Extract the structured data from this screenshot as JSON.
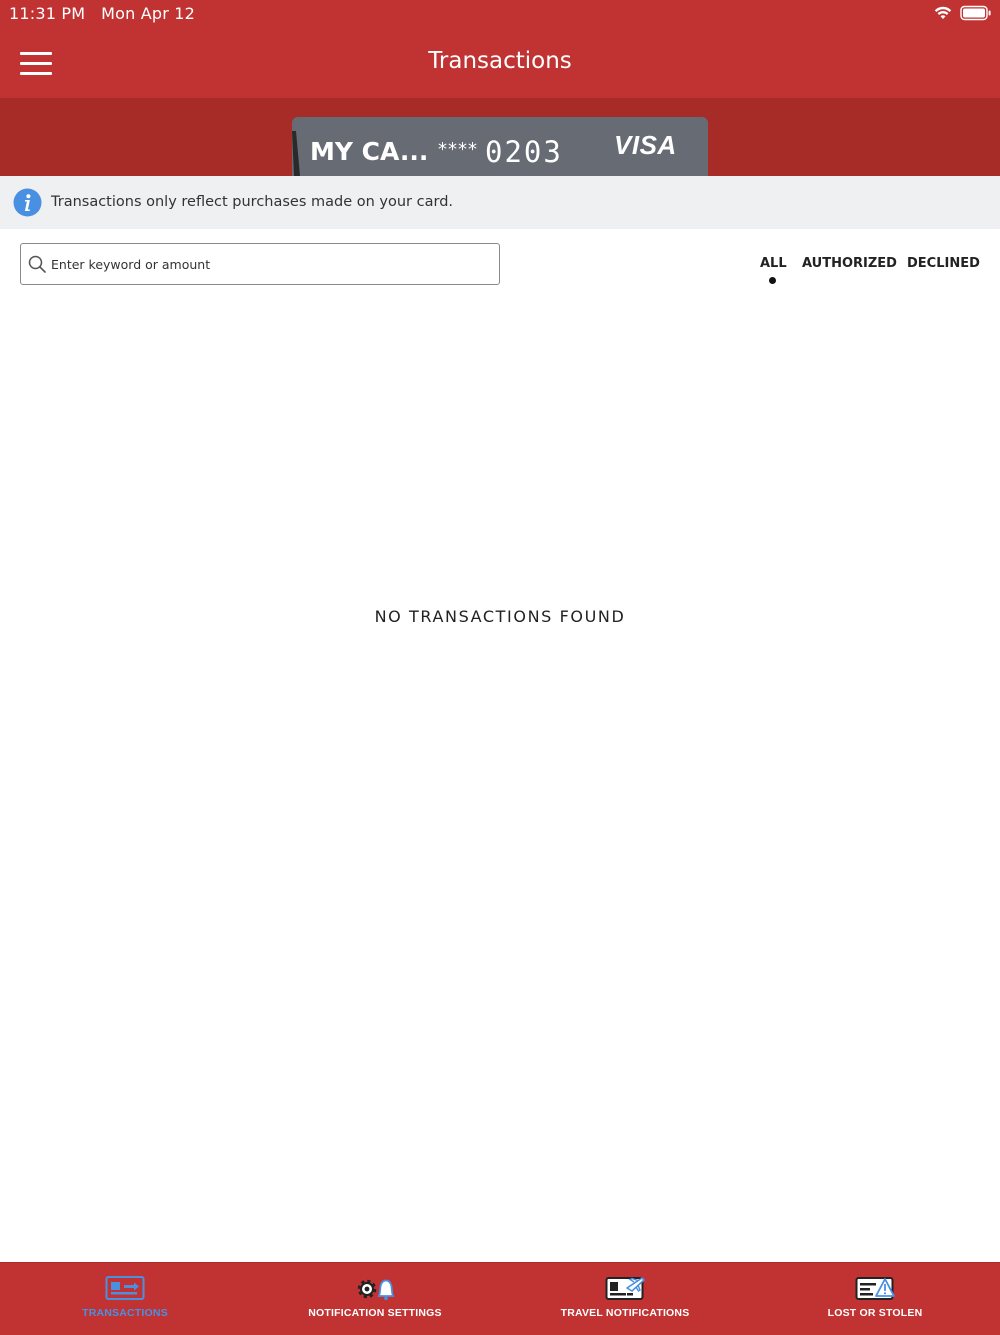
{
  "status_bar": {
    "time": "11:31 PM",
    "date": "Mon Apr 12",
    "wifi_icon": "wifi-icon",
    "battery_icon": "battery-icon"
  },
  "header": {
    "title": "Transactions",
    "menu_icon": "hamburger-menu-icon"
  },
  "card": {
    "name": "MY CA...",
    "mask": "****",
    "last_digits": "0203",
    "brand": "VISA"
  },
  "info_bar": {
    "icon": "info-icon",
    "text": "Transactions only reflect purchases made on your card."
  },
  "search": {
    "placeholder": "Enter keyword or amount",
    "value": ""
  },
  "filter_tabs": [
    {
      "label": "ALL",
      "selected": true
    },
    {
      "label": "AUTHORIZED",
      "selected": false
    },
    {
      "label": "DECLINED",
      "selected": false
    }
  ],
  "empty_state": {
    "message": "NO TRANSACTIONS FOUND"
  },
  "tab_bar": [
    {
      "label": "TRANSACTIONS",
      "icon": "transactions-card-icon",
      "active": true
    },
    {
      "label": "NOTIFICATION SETTINGS",
      "icon": "gear-bell-icon",
      "active": false
    },
    {
      "label": "TRAVEL NOTIFICATIONS",
      "icon": "card-airplane-icon",
      "active": false
    },
    {
      "label": "LOST OR STOLEN",
      "icon": "card-warning-icon",
      "active": false
    }
  ],
  "colors": {
    "header_red": "#c13333",
    "card_band_red": "#a72b27",
    "card_gray": "#676c74",
    "info_background": "#eef0f1",
    "info_blue": "#4a90e2",
    "active_tab_blue": "#4a90e2"
  }
}
